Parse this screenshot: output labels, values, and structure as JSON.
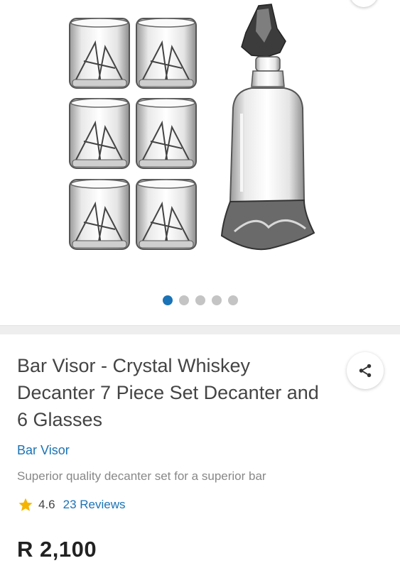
{
  "gallery": {
    "image_alt": "Crystal whiskey decanter with six glasses",
    "dots": [
      true,
      false,
      false,
      false,
      false
    ]
  },
  "product": {
    "title": "Bar Visor - Crystal Whiskey Decanter 7 Piece Set Decanter and 6 Glasses",
    "brand": "Bar Visor",
    "subtitle": "Superior quality decanter set for a superior bar",
    "rating": "4.6",
    "reviews": "23 Reviews",
    "price": "R 2,100"
  },
  "icons": {
    "share": "share-icon",
    "star": "star-icon"
  },
  "colors": {
    "accent": "#1a73b6",
    "star": "#f5b400"
  }
}
